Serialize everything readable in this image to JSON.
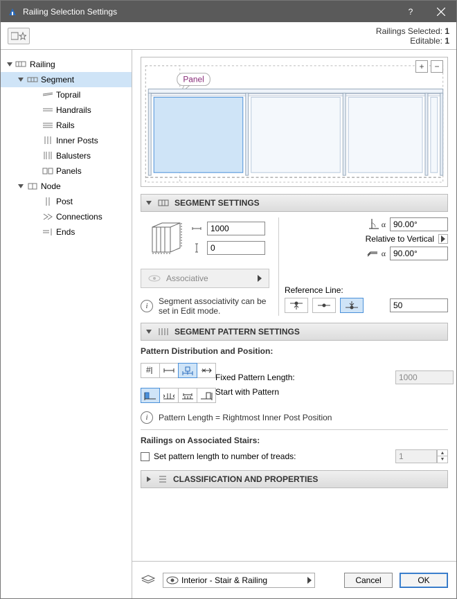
{
  "window": {
    "title": "Railing Selection Settings"
  },
  "status": {
    "selected_label": "Railings Selected:",
    "selected_count": "1",
    "editable_label": "Editable:",
    "editable_count": "1"
  },
  "tree": {
    "railing": "Railing",
    "segment": "Segment",
    "toprail": "Toprail",
    "handrails": "Handrails",
    "rails": "Rails",
    "inner_posts": "Inner Posts",
    "balusters": "Balusters",
    "panels": "Panels",
    "node": "Node",
    "post": "Post",
    "connections": "Connections",
    "ends": "Ends"
  },
  "preview": {
    "tooltip": "Panel"
  },
  "segment_settings": {
    "title": "SEGMENT SETTINGS",
    "width": "1000",
    "offset": "0",
    "associative": "Associative",
    "associativity_note": "Segment associativity can be set in Edit mode.",
    "angle1": "90.00°",
    "relative_to_vertical": "Relative to Vertical",
    "angle2": "90.00°",
    "reference_line": "Reference Line:",
    "ref_value": "50"
  },
  "pattern": {
    "title": "SEGMENT PATTERN SETTINGS",
    "distribution_label": "Pattern Distribution and Position:",
    "fixed_length_label": "Fixed Pattern Length:",
    "fixed_length_value": "1000",
    "start_with_pattern": "Start with Pattern",
    "pattern_length_info": "Pattern Length = Rightmost Inner Post Position",
    "stairs_label": "Railings on Associated Stairs:",
    "set_pattern_treads": "Set pattern length to number of treads:",
    "treads_value": "1"
  },
  "class_props": {
    "title": "CLASSIFICATION AND PROPERTIES"
  },
  "footer": {
    "layer": "Interior - Stair & Railing",
    "cancel": "Cancel",
    "ok": "OK"
  }
}
